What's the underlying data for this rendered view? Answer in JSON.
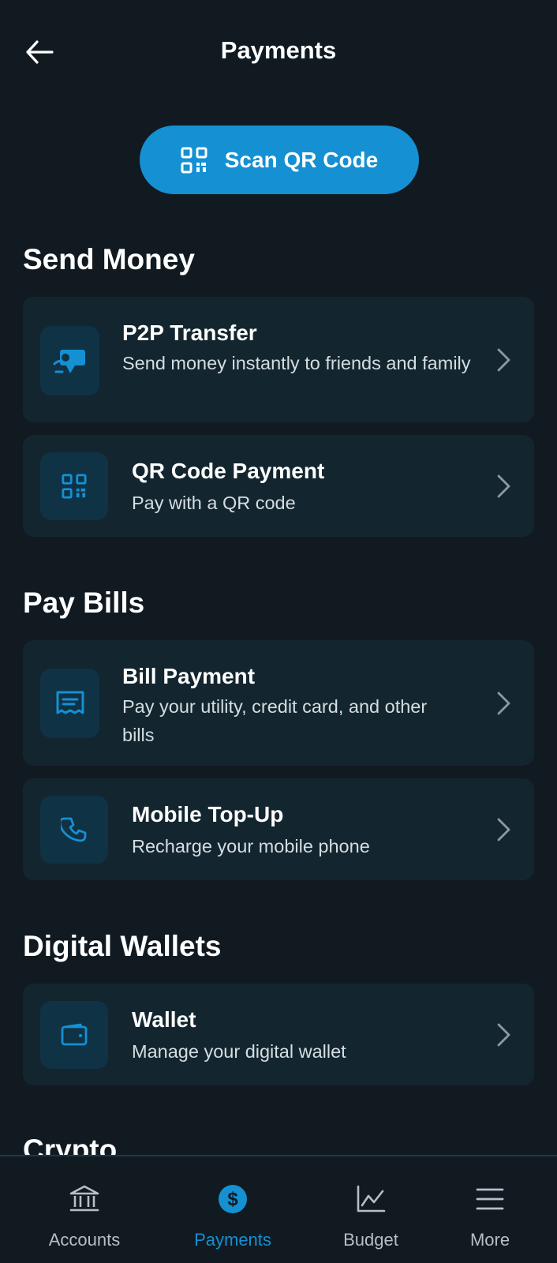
{
  "header": {
    "title": "Payments"
  },
  "scan_button": {
    "label": "Scan QR Code"
  },
  "sections": {
    "send_money": {
      "title": "Send Money",
      "items": [
        {
          "title": "P2P Transfer",
          "description": "Send money instantly to friends and family",
          "icon": "hand-money-icon"
        },
        {
          "title": "QR Code Payment",
          "description": "Pay with a QR code",
          "icon": "qr-code-icon"
        }
      ]
    },
    "pay_bills": {
      "title": "Pay Bills",
      "items": [
        {
          "title": "Bill Payment",
          "description": "Pay your utility, credit card, and other bills",
          "icon": "receipt-icon"
        },
        {
          "title": "Mobile Top-Up",
          "description": "Recharge your mobile phone",
          "icon": "phone-icon"
        }
      ]
    },
    "digital_wallets": {
      "title": "Digital Wallets",
      "items": [
        {
          "title": "Wallet",
          "description": "Manage your digital wallet",
          "icon": "wallet-icon"
        }
      ]
    },
    "crypto": {
      "title": "Crypto"
    }
  },
  "bottom_nav": {
    "items": [
      {
        "label": "Accounts",
        "icon": "bank-icon"
      },
      {
        "label": "Payments",
        "icon": "dollar-circle-icon",
        "active": true
      },
      {
        "label": "Budget",
        "icon": "chart-icon"
      },
      {
        "label": "More",
        "icon": "menu-icon"
      }
    ]
  },
  "colors": {
    "background": "#111a21",
    "card": "#13262f",
    "accent": "#1590d3",
    "icon_tile": "#0f3245"
  }
}
